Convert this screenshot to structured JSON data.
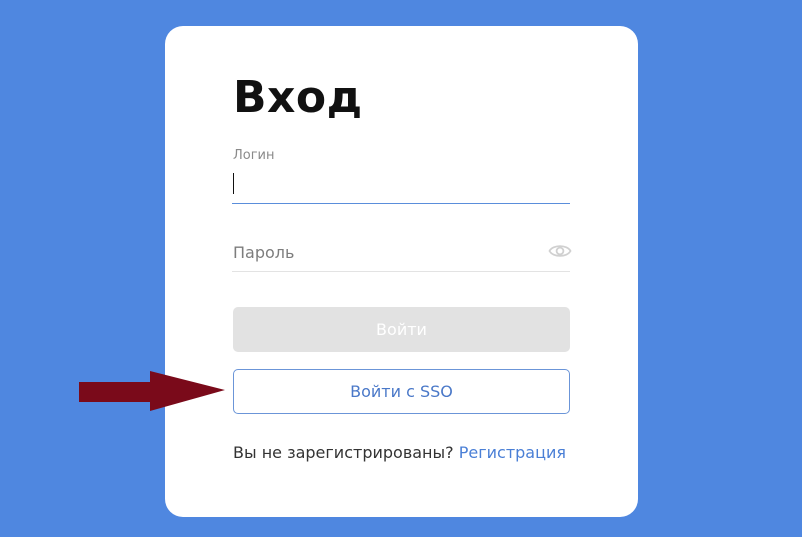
{
  "form": {
    "title": "Вход",
    "login": {
      "label": "Логин",
      "value": ""
    },
    "password": {
      "placeholder": "Пароль",
      "value": ""
    },
    "login_button": "Войти",
    "sso_button": "Войти с SSO",
    "register_prompt": "Вы не зарегистрированы?",
    "register_link": "Регистрация"
  },
  "icons": {
    "password_toggle": "eye-icon",
    "annotation": "arrow-right-icon"
  },
  "colors": {
    "background": "#4f87e0",
    "card": "#ffffff",
    "accent": "#4a7fd6",
    "disabled_button": "#e2e2e2",
    "arrow": "#7a0a1a"
  }
}
